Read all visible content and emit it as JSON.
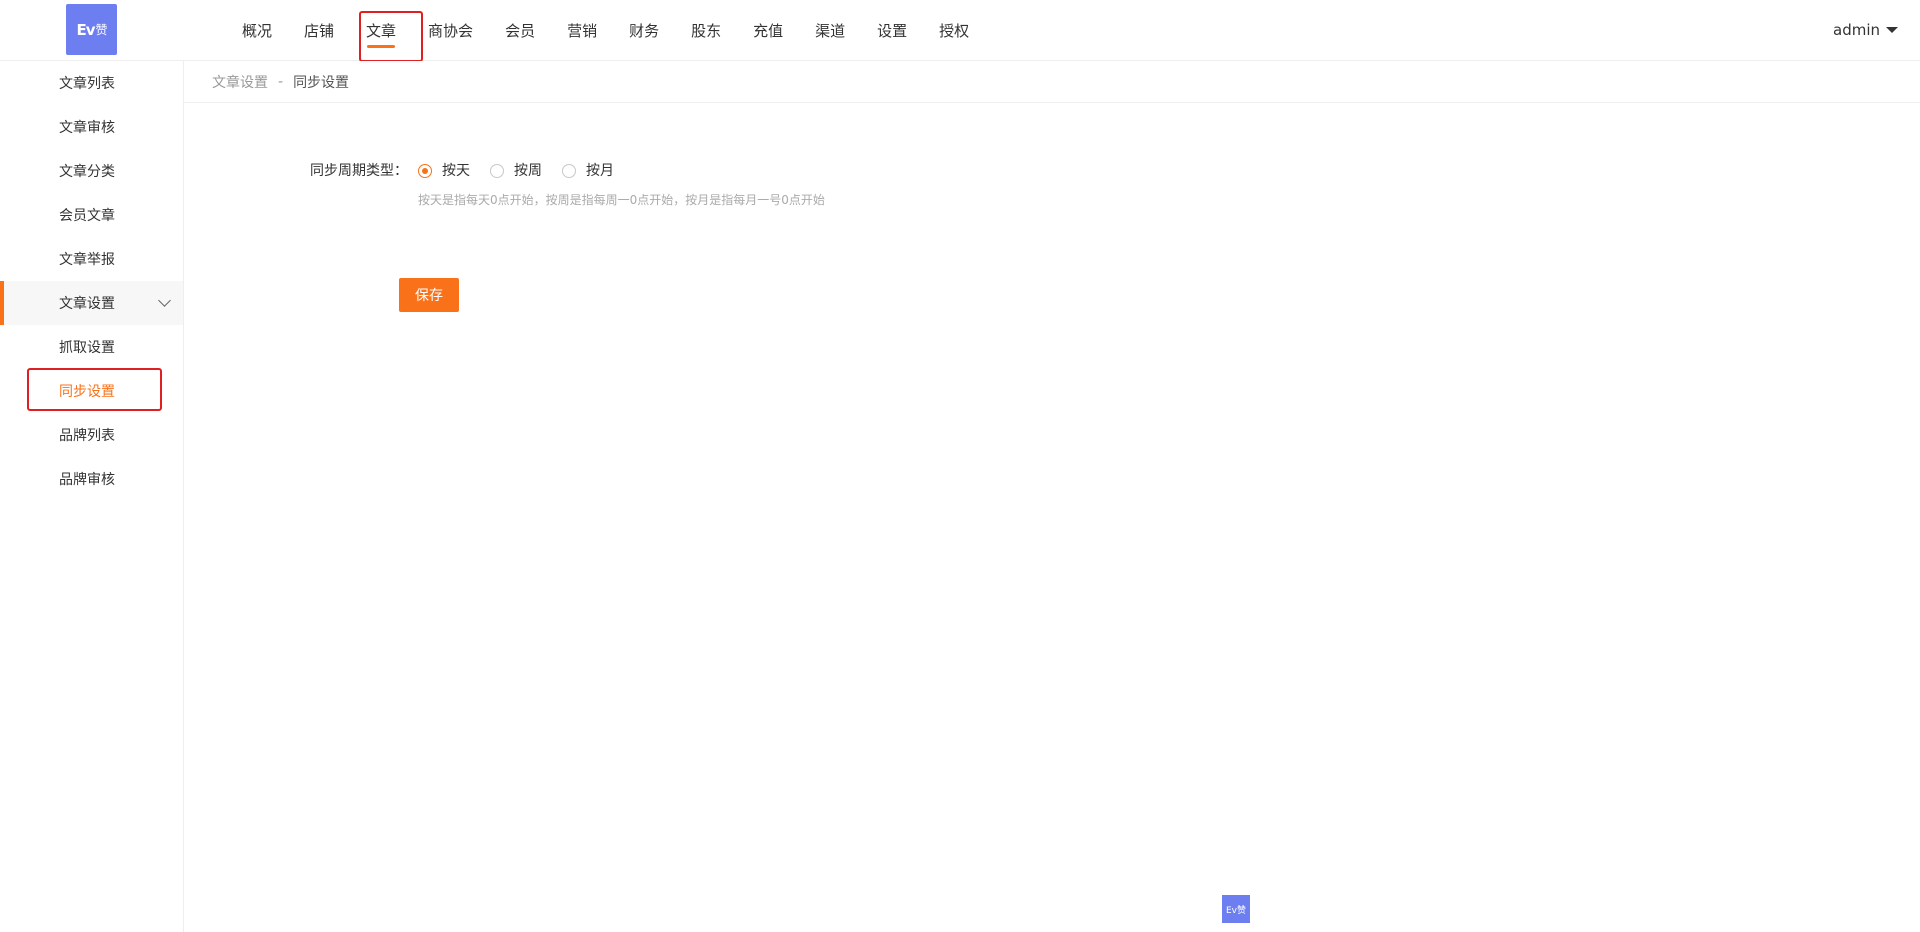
{
  "logo": {
    "text": "Ev",
    "text_cn": "赞"
  },
  "nav": {
    "items": [
      {
        "label": "概况"
      },
      {
        "label": "店铺"
      },
      {
        "label": "文章",
        "active": true
      },
      {
        "label": "商协会"
      },
      {
        "label": "会员"
      },
      {
        "label": "营销"
      },
      {
        "label": "财务"
      },
      {
        "label": "股东"
      },
      {
        "label": "充值"
      },
      {
        "label": "渠道"
      },
      {
        "label": "设置"
      },
      {
        "label": "授权"
      }
    ]
  },
  "user": {
    "name": "admin"
  },
  "sidebar": {
    "items": [
      {
        "label": "文章列表"
      },
      {
        "label": "文章审核"
      },
      {
        "label": "文章分类"
      },
      {
        "label": "会员文章"
      },
      {
        "label": "文章举报"
      },
      {
        "label": "文章设置"
      },
      {
        "label": "抓取设置"
      },
      {
        "label": "同步设置"
      },
      {
        "label": "品牌列表"
      },
      {
        "label": "品牌审核"
      }
    ]
  },
  "breadcrumb": {
    "parent": "文章设置",
    "separator": "-",
    "current": "同步设置"
  },
  "form": {
    "label": "同步周期类型：",
    "options": [
      "按天",
      "按周",
      "按月"
    ],
    "selected": "按天",
    "hint": "按天是指每天0点开始，按周是指每周一0点开始，按月是指每月一号0点开始"
  },
  "save_label": "保存",
  "footer_logo": {
    "text": "Ev赞"
  },
  "colors": {
    "accent": "#f97219",
    "brand": "#6d7ef0",
    "highlight": "#e02020"
  }
}
